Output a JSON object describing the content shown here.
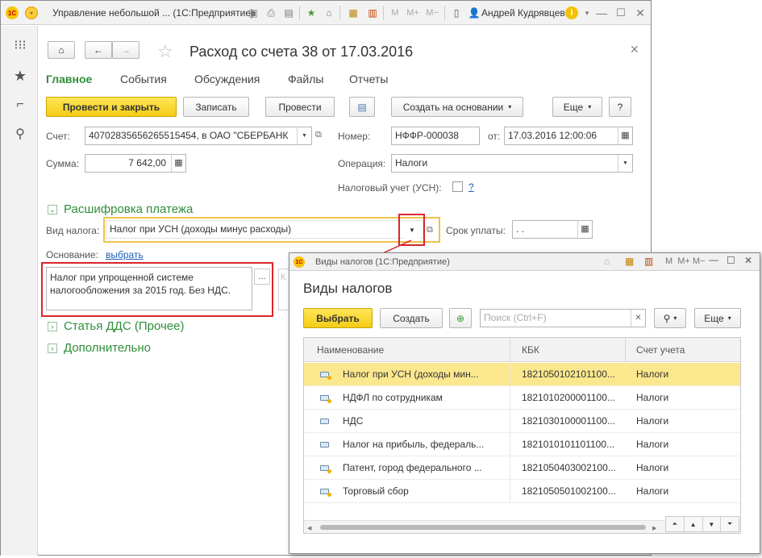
{
  "titlebar": {
    "app_title": "Управление небольшой ... (1С:Предприятие)",
    "user": "Андрей Кудрявцев",
    "m_buttons": [
      "M",
      "M+",
      "M−"
    ]
  },
  "document": {
    "title": "Расход со счета 38 от 17.03.2016",
    "tabs": [
      "Главное",
      "События",
      "Обсуждения",
      "Файлы",
      "Отчеты"
    ],
    "toolbar": {
      "post_close": "Провести и закрыть",
      "save": "Записать",
      "post": "Провести",
      "create_basis": "Создать на основании",
      "more": "Еще",
      "help": "?"
    },
    "account_label": "Счет:",
    "account_value": "40702835656265515454, в ОАО \"СБЕРБАНК",
    "number_label": "Номер:",
    "number_value": "НФФР-000038",
    "date_label": "от:",
    "date_value": "17.03.2016 12:00:06",
    "sum_label": "Сумма:",
    "sum_value": "7 642,00",
    "operation_label": "Операция:",
    "operation_value": "Налоги",
    "tax_accounting_label": "Налоговый учет (УСН):",
    "tax_accounting_help": "?",
    "section_payment": "Расшифровка платежа",
    "tax_type_label": "Вид налога:",
    "tax_type_value": "Налог при УСН (доходы минус расходы)",
    "due_label": "Срок уплаты:",
    "due_value": " .  .",
    "basis_label": "Основание:",
    "basis_link": "выбрать",
    "basis_text": "Налог при упрощенной системе налогообложения за 2015 год. Без НДС.",
    "section_dds": "Статья ДДС (Прочее)",
    "section_extra": "Дополнительно"
  },
  "popup": {
    "window_title": "Виды налогов (1С:Предприятие)",
    "heading": "Виды налогов",
    "select_button": "Выбрать",
    "create_button": "Создать",
    "search_placeholder": "Поиск (Ctrl+F)",
    "more_button": "Еще",
    "columns": [
      "Наименование",
      "КБК",
      "Счет учета"
    ],
    "rows": [
      {
        "name": "Налог при УСН (доходы мин...",
        "kbk": "1821050102101100...",
        "account": "Налоги"
      },
      {
        "name": "НДФЛ по сотрудникам",
        "kbk": "1821010200001100...",
        "account": "Налоги"
      },
      {
        "name": "НДС",
        "kbk": "1821030100001100...",
        "account": "Налоги"
      },
      {
        "name": "Налог на прибыль, федераль...",
        "kbk": "1821010101101100...",
        "account": "Налоги"
      },
      {
        "name": "Патент, город федерального ...",
        "kbk": "1821050403002100...",
        "account": "Налоги"
      },
      {
        "name": "Торговый сбор",
        "kbk": "1821050501002100...",
        "account": "Налоги"
      }
    ]
  }
}
